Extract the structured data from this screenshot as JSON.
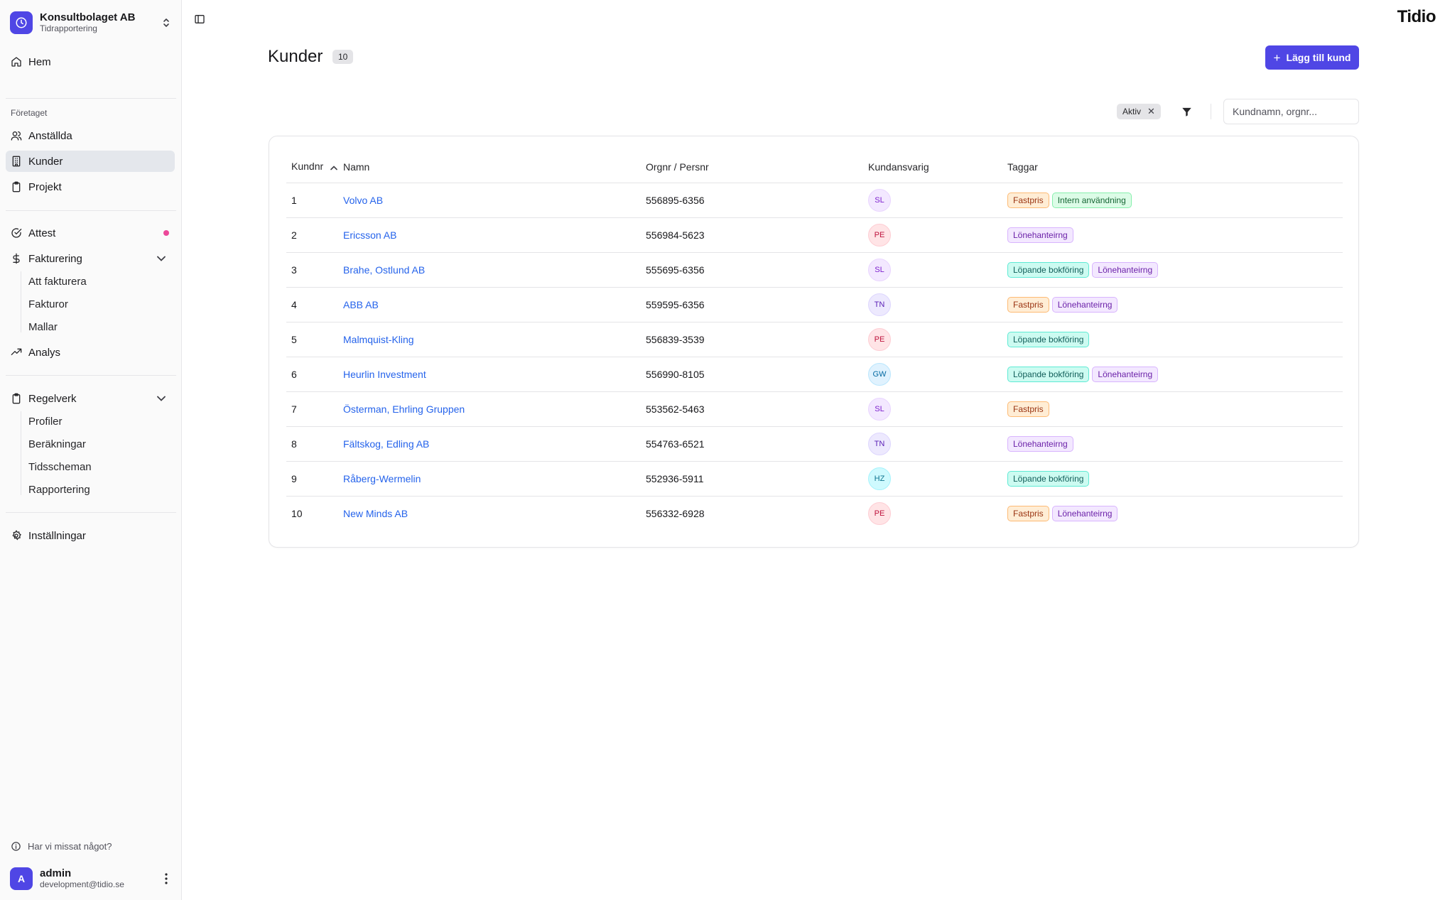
{
  "app": {
    "org_name": "Konsultbolaget AB",
    "org_subtitle": "Tidrapportering",
    "brand": "Tidio"
  },
  "sidebar": {
    "home": "Hem",
    "company_section": "Företaget",
    "employees": "Anställda",
    "customers": "Kunder",
    "projects": "Projekt",
    "attest": "Attest",
    "invoicing": "Fakturering",
    "invoicing_items": [
      "Att fakturera",
      "Fakturor",
      "Mallar"
    ],
    "analysis": "Analys",
    "rules": "Regelverk",
    "rules_items": [
      "Profiler",
      "Beräkningar",
      "Tidsscheman",
      "Rapportering"
    ],
    "settings": "Inställningar",
    "help": "Har vi missat något?",
    "user_name": "admin",
    "user_email": "development@tidio.se",
    "user_initial": "A"
  },
  "page": {
    "title": "Kunder",
    "count": "10",
    "add_button": "Lägg till kund",
    "filter_chip": "Aktiv",
    "search_placeholder": "Kundnamn, orgnr..."
  },
  "table": {
    "columns": [
      "Kundnr",
      "Namn",
      "Orgnr / Persnr",
      "Kundansvarig",
      "Taggar"
    ],
    "rows": [
      {
        "nr": "1",
        "name": "Volvo AB",
        "org": "556895-6356",
        "resp": "SL",
        "tags": [
          "Fastpris",
          "Intern användning"
        ]
      },
      {
        "nr": "2",
        "name": "Ericsson AB",
        "org": "556984-5623",
        "resp": "PE",
        "tags": [
          "Lönehanteirng"
        ]
      },
      {
        "nr": "3",
        "name": "Brahe, Ostlund AB",
        "org": "555695-6356",
        "resp": "SL",
        "tags": [
          "Löpande bokföring",
          "Lönehanteirng"
        ]
      },
      {
        "nr": "4",
        "name": "ABB AB",
        "org": "559595-6356",
        "resp": "TN",
        "tags": [
          "Fastpris",
          "Lönehanteirng"
        ]
      },
      {
        "nr": "5",
        "name": "Malmquist-Kling",
        "org": "556839-3539",
        "resp": "PE",
        "tags": [
          "Löpande bokföring"
        ]
      },
      {
        "nr": "6",
        "name": "Heurlin Investment",
        "org": "556990-8105",
        "resp": "GW",
        "tags": [
          "Löpande bokföring",
          "Lönehanteirng"
        ]
      },
      {
        "nr": "7",
        "name": "Österman, Ehrling Gruppen",
        "org": "553562-5463",
        "resp": "SL",
        "tags": [
          "Fastpris"
        ]
      },
      {
        "nr": "8",
        "name": "Fältskog, Edling AB",
        "org": "554763-6521",
        "resp": "TN",
        "tags": [
          "Lönehanteirng"
        ]
      },
      {
        "nr": "9",
        "name": "Råberg-Wermelin",
        "org": "552936-5911",
        "resp": "HZ",
        "tags": [
          "Löpande bokföring"
        ]
      },
      {
        "nr": "10",
        "name": "New Minds AB",
        "org": "556332-6928",
        "resp": "PE",
        "tags": [
          "Fastpris",
          "Lönehanteirng"
        ]
      }
    ]
  },
  "colors": {
    "accent": "#4f46e5",
    "link": "#2563eb",
    "attest_dot": "#ec4899",
    "avatars": {
      "SL": {
        "bg": "#f3e8ff",
        "border": "#e9d5ff",
        "fg": "#7e22ce"
      },
      "PE": {
        "bg": "#ffe4e6",
        "border": "#fecdd3",
        "fg": "#be123c"
      },
      "TN": {
        "bg": "#ede9fe",
        "border": "#ddd6fe",
        "fg": "#5b21b6"
      },
      "GW": {
        "bg": "#e0f2fe",
        "border": "#bae6fd",
        "fg": "#0369a1"
      },
      "HZ": {
        "bg": "#cffafe",
        "border": "#a5f3fc",
        "fg": "#0e7490"
      }
    },
    "tags": {
      "Fastpris": {
        "bg": "#ffedd5",
        "border": "#fdba74",
        "fg": "#9a3412"
      },
      "Intern användning": {
        "bg": "#dcfce7",
        "border": "#86efac",
        "fg": "#166534"
      },
      "Lönehanteirng": {
        "bg": "#f3e8ff",
        "border": "#d8b4fe",
        "fg": "#6b21a8"
      },
      "Löpande bokföring": {
        "bg": "#ccfbf1",
        "border": "#5eead4",
        "fg": "#115e59"
      }
    }
  }
}
